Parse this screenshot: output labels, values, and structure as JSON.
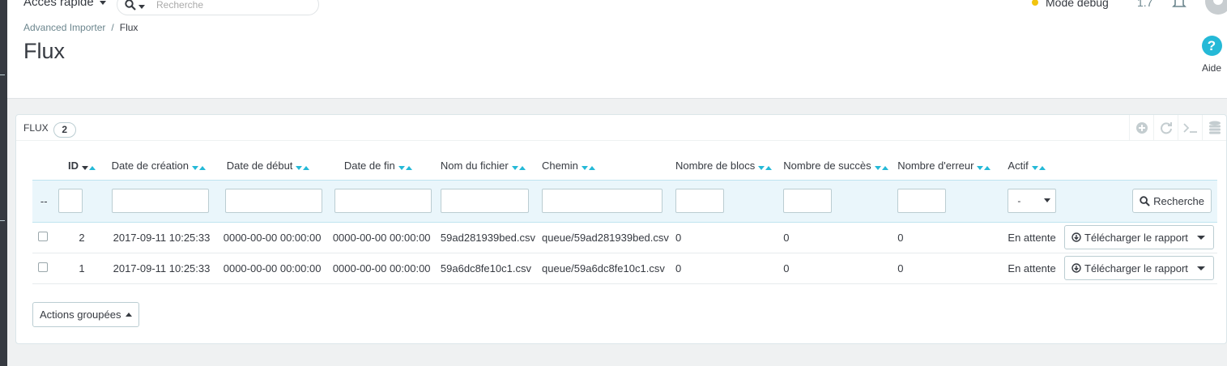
{
  "topbar": {
    "quick_access": "Accès rapide",
    "search_placeholder": "Recherche",
    "debug_mode": "Mode debug",
    "version": "1.7"
  },
  "breadcrumb": {
    "parent": "Advanced Importer",
    "separator": "/",
    "current": "Flux"
  },
  "page_title": "Flux",
  "help": {
    "icon": "?",
    "label": "Aide"
  },
  "panel": {
    "title": "FLUX",
    "count": "2",
    "tools": [
      "add-icon",
      "refresh-icon",
      "terminal-icon",
      "database-icon"
    ]
  },
  "table": {
    "columns": [
      "ID",
      "Date de création",
      "Date de début",
      "Date de fin",
      "Nom du fichier",
      "Chemin",
      "Nombre de blocs",
      "Nombre de succès",
      "Nombre d'erreur",
      "Actif"
    ],
    "filter": {
      "bulk_placeholder": "--",
      "active_selected": "-",
      "search_button": "Recherche"
    },
    "rows": [
      {
        "id": "2",
        "created": "2017-09-11 10:25:33",
        "start": "0000-00-00 00:00:00",
        "end": "0000-00-00 00:00:00",
        "filename": "59ad281939bed.csv",
        "path": "queue/59ad281939bed.csv",
        "blocks": "0",
        "success": "0",
        "errors": "0",
        "status": "En attente",
        "action": "Télécharger le rapport"
      },
      {
        "id": "1",
        "created": "2017-09-11 10:25:33",
        "start": "0000-00-00 00:00:00",
        "end": "0000-00-00 00:00:00",
        "filename": "59a6dc8fe10c1.csv",
        "path": "queue/59a6dc8fe10c1.csv",
        "blocks": "0",
        "success": "0",
        "errors": "0",
        "status": "En attente",
        "action": "Télécharger le rapport"
      }
    ]
  },
  "bulk_actions": "Actions groupées",
  "colors": {
    "accent": "#25b9d7",
    "text": "#363a41",
    "sidebar": "#363a41",
    "filter_row": "#eaf6fb"
  }
}
